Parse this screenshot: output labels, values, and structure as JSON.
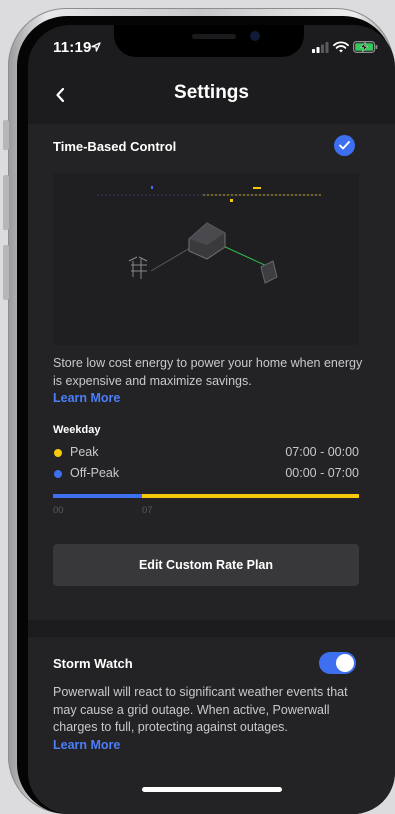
{
  "status_bar": {
    "time": "11:19"
  },
  "header": {
    "title": "Settings",
    "back_icon": "chevron-left-icon"
  },
  "time_based_control": {
    "title": "Time-Based Control",
    "enabled": true,
    "description": "Store low cost energy to power your home when energy is expensive and maximize savings.",
    "learn_more": "Learn More",
    "schedule": {
      "title": "Weekday",
      "periods": [
        {
          "label": "Peak",
          "time": "07:00 - 00:00",
          "color": "#f6c90e"
        },
        {
          "label": "Off-Peak",
          "time": "00:00 - 07:00",
          "color": "#3d6ff0"
        }
      ],
      "timeline_labels": [
        "00",
        "07"
      ]
    },
    "edit_button": "Edit Custom Rate Plan"
  },
  "storm_watch": {
    "title": "Storm Watch",
    "enabled": true,
    "description": "Powerwall will react to significant weather events that may cause a grid outage. When active, Powerwall charges to full, protecting against outages.",
    "learn_more": "Learn More"
  },
  "colors": {
    "accent": "#3d6ff0",
    "peak": "#f6c90e",
    "off_peak": "#3d6ff0",
    "background": "#1c1c1e",
    "card": "#232325"
  }
}
